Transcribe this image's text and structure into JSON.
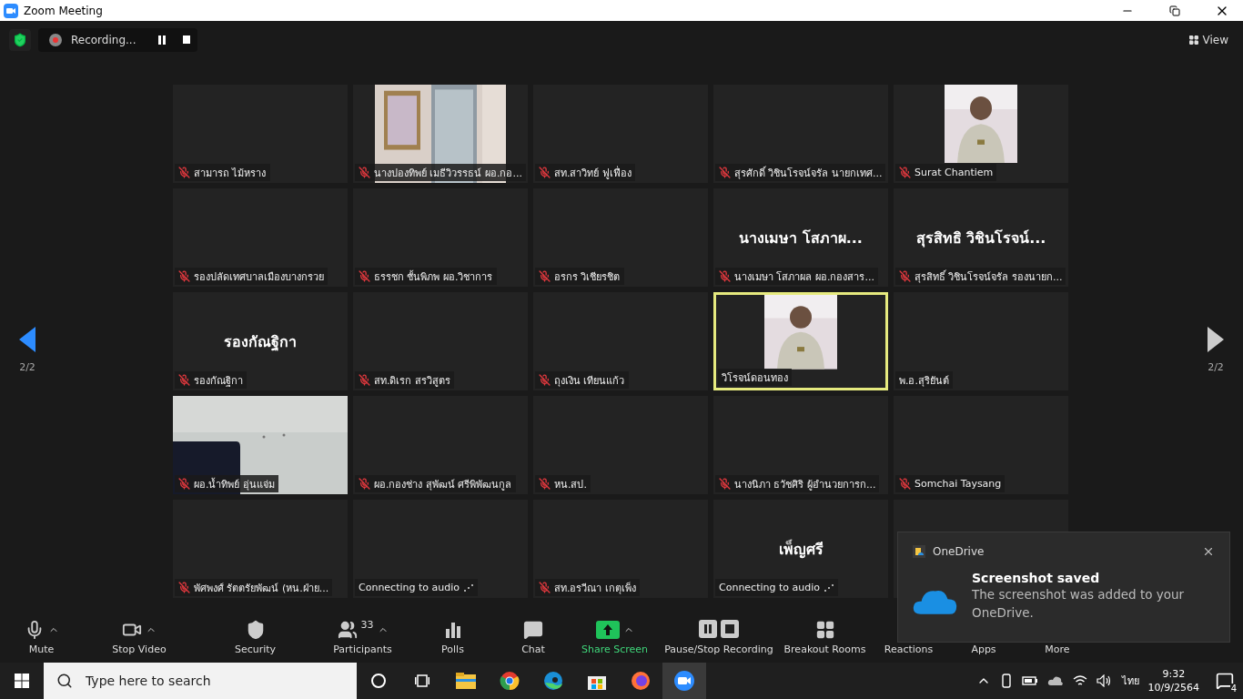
{
  "window": {
    "title": "Zoom Meeting"
  },
  "top_bar": {
    "recording": "Recording...",
    "view": "View"
  },
  "pager": {
    "left": "2/2",
    "right": "2/2"
  },
  "tiles": [
    {
      "label": "สามารถ ไม้หราง",
      "muted": true,
      "speaking": false
    },
    {
      "label": "นางปองทิพย์ เมธีวิวรรธน์ ผอ.กอ...",
      "muted": true,
      "speaking": false,
      "kind": "wide"
    },
    {
      "label": "สท.สาวิทย์  ฟูเฟื่อง",
      "muted": true,
      "speaking": false
    },
    {
      "label": "สุรศักดิ์ วิชินโรจน์จรัล นายกเทศ...",
      "muted": true,
      "speaking": false
    },
    {
      "label": "Surat Chantiem",
      "muted": true,
      "speaking": false,
      "kind": "narrow"
    },
    {
      "label": "รองปลัดเทศบาลเมืองบางกรวย",
      "muted": true,
      "speaking": false
    },
    {
      "label": "ธรรชก ชั้นพิภพ ผอ.วิชาการ",
      "muted": true,
      "speaking": false
    },
    {
      "label": "อรกร วิเชียรชิต",
      "muted": true,
      "speaking": false
    },
    {
      "label": "นางเมษา  โสภาผล ผอ.กองสาร...",
      "muted": true,
      "speaking": false,
      "big_name": "นางเมษา  โสภาผ..."
    },
    {
      "label": "สุรสิทธิ์ วิชินโรจน์จรัล รองนายก...",
      "muted": true,
      "speaking": false,
      "big_name": "สุรสิทธิ วิชินโรจน์..."
    },
    {
      "label": "รองกัณฐิกา",
      "muted": true,
      "speaking": false,
      "big_name": "รองกัณฐิกา"
    },
    {
      "label": "สท.ดิเรก สรวิสูตร",
      "muted": true,
      "speaking": false
    },
    {
      "label": "ถุงเงิน เทียนแก้ว",
      "muted": true,
      "speaking": false
    },
    {
      "label": "วิโรจน์ดอนทอง",
      "muted": false,
      "speaking": true,
      "kind": "narrow"
    },
    {
      "label": "พ.อ.สุริยันต์",
      "muted": false,
      "speaking": false
    },
    {
      "label": "ผอ.น้ำทิพย์ อุ่นแจ่ม",
      "muted": true,
      "speaking": false,
      "kind": "full"
    },
    {
      "label": "ผอ.กองช่าง สุพัฒน์ ศรีพิพัฒนกูล",
      "muted": true,
      "speaking": false
    },
    {
      "label": "หน.สป.",
      "muted": true,
      "speaking": false
    },
    {
      "label": "นางนิภา ธวัชศิริ  ผู้อำนวยการก...",
      "muted": true,
      "speaking": false
    },
    {
      "label": "Somchai Taysang",
      "muted": true,
      "speaking": false
    },
    {
      "label": "พัศพงศ์ รัตตรัยพัฒน์ (หน.ฝ่าย...",
      "muted": true,
      "speaking": false
    },
    {
      "label": "Connecting to audio",
      "muted": false,
      "speaking": false,
      "connecting": true
    },
    {
      "label": "สท.อรวีณา เกตุเพ็ง",
      "muted": true,
      "speaking": false
    },
    {
      "label": "Connecting to audio",
      "muted": false,
      "speaking": false,
      "connecting": true,
      "big_name": "เพ็ญศรี"
    },
    {
      "speaking": false
    }
  ],
  "toolbar": [
    {
      "label": "Mute",
      "caret": true
    },
    {
      "label": "Stop Video",
      "caret": true
    },
    {
      "label": "Security",
      "caret": false
    },
    {
      "label": "Participants",
      "caret": true,
      "count": "33"
    },
    {
      "label": "Polls",
      "caret": false
    },
    {
      "label": "Chat",
      "caret": false
    },
    {
      "label": "Share Screen",
      "caret": true,
      "kind": "share"
    },
    {
      "label": "Pause/Stop Recording",
      "caret": false
    },
    {
      "label": "Breakout Rooms",
      "caret": false
    },
    {
      "label": "Reactions",
      "caret": false
    },
    {
      "label": "Apps",
      "caret": false
    },
    {
      "label": "More",
      "caret": false
    }
  ],
  "notification": {
    "app": "OneDrive",
    "title": "Screenshot saved",
    "body": "The screenshot was added to your OneDrive."
  },
  "taskbar": {
    "search": {
      "placeholder": "Type here to search"
    },
    "language": "ไทย",
    "time": "9:32",
    "date": "10/9/2564",
    "notifications": "4"
  }
}
